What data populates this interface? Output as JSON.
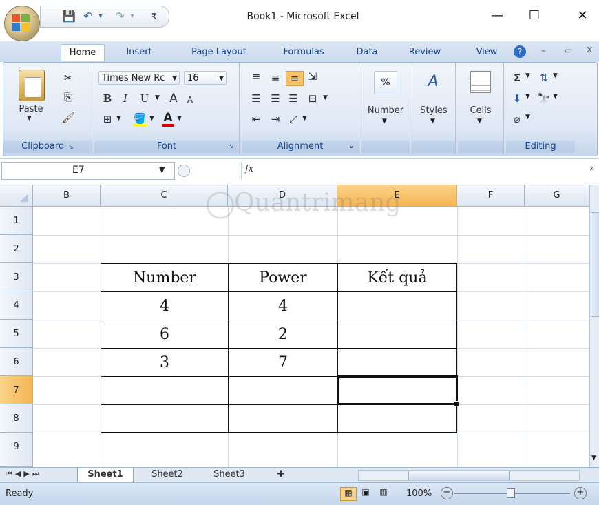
{
  "window": {
    "title": "Book1 - Microsoft Excel",
    "min_label": "—",
    "max_label": "☐",
    "close_label": "✕"
  },
  "qat": {
    "save_icon": "save-icon",
    "undo_icon": "undo-icon",
    "redo_icon": "redo-icon",
    "customize_icon": "customize-icon"
  },
  "tabs": [
    {
      "label": "Home"
    },
    {
      "label": "Insert"
    },
    {
      "label": "Page Layout"
    },
    {
      "label": "Formulas"
    },
    {
      "label": "Data"
    },
    {
      "label": "Review"
    },
    {
      "label": "View"
    }
  ],
  "ribbon": {
    "clipboard": {
      "label": "Clipboard",
      "paste": "Paste"
    },
    "font": {
      "label": "Font",
      "name": "Times New Rc",
      "size": "16",
      "bold": "B",
      "italic": "I",
      "underline": "U",
      "grow": "A",
      "shrink": "A"
    },
    "alignment": {
      "label": "Alignment"
    },
    "number": {
      "label": "Number",
      "symbol": "%"
    },
    "styles": {
      "label": "Styles"
    },
    "cells": {
      "label": "Cells"
    },
    "editing": {
      "label": "Editing",
      "sum": "Σ"
    }
  },
  "formula_bar": {
    "cell_ref": "E7",
    "fx": "fx",
    "value": ""
  },
  "columns": [
    "B",
    "C",
    "D",
    "E",
    "F",
    "G"
  ],
  "rows": [
    "1",
    "2",
    "3",
    "4",
    "5",
    "6",
    "7",
    "8",
    "9"
  ],
  "table": {
    "headers": [
      "Number",
      "Power",
      "Kết quả"
    ],
    "rows": [
      [
        "4",
        "4",
        ""
      ],
      [
        "6",
        "2",
        ""
      ],
      [
        "3",
        "7",
        ""
      ],
      [
        "",
        "",
        ""
      ],
      [
        "",
        "",
        ""
      ]
    ]
  },
  "watermark": "Quantrimang",
  "sheets": [
    {
      "label": "Sheet1",
      "active": true
    },
    {
      "label": "Sheet2"
    },
    {
      "label": "Sheet3"
    }
  ],
  "status": {
    "ready": "Ready",
    "zoom": "100%"
  },
  "colors": {
    "ribbon_text": "#15428b",
    "selected_col": "#f8c677",
    "selected_row": "#f4c27a"
  }
}
